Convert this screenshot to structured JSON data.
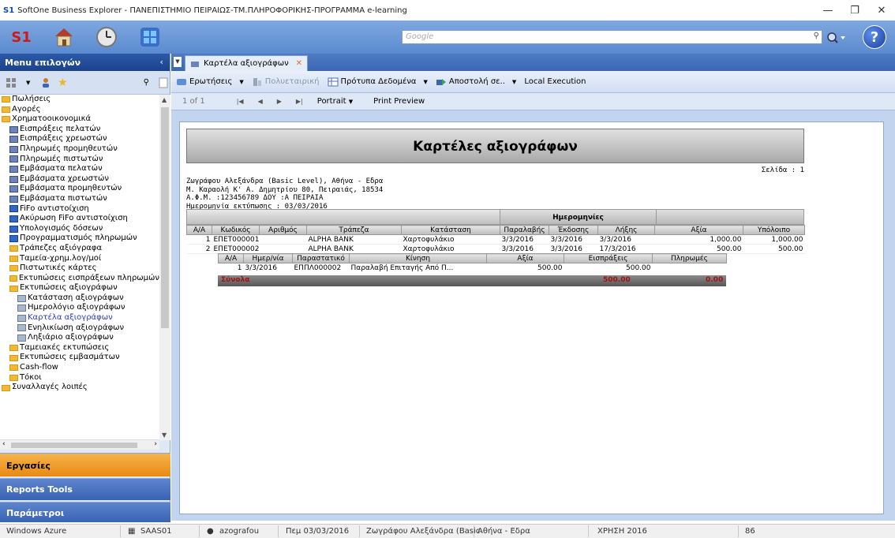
{
  "window": {
    "logo": "S1",
    "title": "SoftOne Business Explorer - ΠΑΝΕΠΙΣΤΗΜΙΟ ΠΕΙΡΑΙΩΣ-ΤΜ.ΠΛΗΡΟΦΟΡΙΚΗΣ-ΠΡΟΓΡΑΜΜΑ e-learning"
  },
  "search": {
    "placeholder": "Google"
  },
  "sidebar": {
    "header": "Menu επιλογών",
    "tree": [
      {
        "label": "Πωλήσεις",
        "type": "folder",
        "indent": 0
      },
      {
        "label": "Αγορές",
        "type": "folder",
        "indent": 0
      },
      {
        "label": "Χρηματοοικονομικά",
        "type": "folder",
        "indent": 0
      },
      {
        "label": "Εισπράξεις πελατών",
        "type": "doc",
        "indent": 1
      },
      {
        "label": "Εισπράξεις χρεωστών",
        "type": "doc",
        "indent": 1
      },
      {
        "label": "Πληρωμές προμηθευτών",
        "type": "doc",
        "indent": 1
      },
      {
        "label": "Πληρωμές πιστωτών",
        "type": "doc",
        "indent": 1
      },
      {
        "label": "Εμβάσματα πελατών",
        "type": "doc",
        "indent": 1
      },
      {
        "label": "Εμβάσματα χρεωστών",
        "type": "doc",
        "indent": 1
      },
      {
        "label": "Εμβάσματα προμηθευτών",
        "type": "doc",
        "indent": 1
      },
      {
        "label": "Εμβάσματα πιστωτών",
        "type": "doc",
        "indent": 1
      },
      {
        "label": "FiFo αντιστοίχιση",
        "type": "fifo",
        "indent": 1
      },
      {
        "label": "Ακύρωση FiFo αντιστοίχιση",
        "type": "fifo",
        "indent": 1
      },
      {
        "label": "Υπολογισμός δόσεων",
        "type": "fifo",
        "indent": 1
      },
      {
        "label": "Προγραμματισμός πληρωμών",
        "type": "fifo",
        "indent": 1
      },
      {
        "label": "Τράπεζες αξιόγραφα",
        "type": "folder",
        "indent": 1
      },
      {
        "label": "Ταμεία-χρημ.λογ/μοί",
        "type": "folder",
        "indent": 1
      },
      {
        "label": "Πιστωτικές κάρτες",
        "type": "folder",
        "indent": 1
      },
      {
        "label": "Εκτυπώσεις εισπράξεων πληρωμών",
        "type": "folder",
        "indent": 1
      },
      {
        "label": "Εκτυπώσεις αξιογράφων",
        "type": "folder",
        "indent": 1
      },
      {
        "label": "Κατάσταση αξιογράφων",
        "type": "report",
        "indent": 2
      },
      {
        "label": "Ημερολόγιο αξιογράφων",
        "type": "report",
        "indent": 2
      },
      {
        "label": "Καρτέλα αξιογράφων",
        "type": "report",
        "indent": 2,
        "active": true
      },
      {
        "label": "Ενηλικίωση αξιογράφων",
        "type": "report",
        "indent": 2
      },
      {
        "label": "Ληξιάριο αξιογράφων",
        "type": "report",
        "indent": 2
      },
      {
        "label": "Ταμειακές εκτυπώσεις",
        "type": "folder",
        "indent": 1
      },
      {
        "label": "Εκτυπώσεις εμβασμάτων",
        "type": "folder",
        "indent": 1
      },
      {
        "label": "Cash-flow",
        "type": "folder",
        "indent": 1
      },
      {
        "label": "Τόκοι",
        "type": "folder",
        "indent": 1
      },
      {
        "label": "Συναλλαγές λοιπές",
        "type": "folder",
        "indent": 0
      }
    ],
    "nav": {
      "ergasies": "Εργασίες",
      "reports": "Reports Tools",
      "params": "Παράμετροι"
    }
  },
  "tab": {
    "label": "Καρτέλα αξιογράφων"
  },
  "toolbar": {
    "queries": "Ερωτήσεις",
    "multi": "Πολυεταιρική",
    "templates": "Πρότυπα Δεδομένα",
    "send": "Αποστολή σε..",
    "local": "Local Execution"
  },
  "pager": {
    "page_text": "1 of 1",
    "portrait": "Portrait",
    "print_preview": "Print Preview"
  },
  "report": {
    "title": "Καρτέλες αξιογράφων",
    "page_label": "Σελίδα : 1",
    "company": [
      "Ζωγράφου Αλεξάνδρα (Basic Level), Αθήνα - Εδρα",
      "Μ. Καραολή Κ' Α. Δημητρίου 80, Πειραιάς, 18534",
      "Α.Φ.Μ. :123456789 ΔΟΥ :Α ΠΕΙΡΑΙΑ",
      "Ημερομηνία εκτύπωσης : 03/03/2016"
    ],
    "dates_header": "Ημερομηνίες",
    "columns": [
      "Α/Α",
      "Κωδικός",
      "Αριθμός",
      "Τράπεζα",
      "Κατάσταση",
      "Παραλαβής",
      "Έκδοσης",
      "Λήξης",
      "Αξία",
      "Υπόλοιπο"
    ],
    "rows": [
      [
        "1",
        "ΕΠΕΤ000001",
        "",
        "ALPHA BANK",
        "Χαρτοφυλάκιο",
        "3/3/2016",
        "3/3/2016",
        "3/3/2016",
        "1,000.00",
        "1,000.00"
      ],
      [
        "2",
        "ΕΠΕΤ000002",
        "",
        "ALPHA BANK",
        "Χαρτοφυλάκιο",
        "3/3/2016",
        "3/3/2016",
        "17/3/2016",
        "500.00",
        "500.00"
      ]
    ],
    "sub_columns": [
      "Α/Α",
      "Ημερ/νία",
      "Παραστατικό",
      "Κίνηση",
      "Αξία",
      "Εισπράξεις",
      "Πληρωμές"
    ],
    "sub_rows": [
      [
        "1",
        "3/3/2016",
        "ΕΠΠΛ000002",
        "Παραλαβή Επιταγής Από Π...",
        "500.00",
        "500.00",
        ""
      ]
    ],
    "totals": {
      "label": "Σύνολα",
      "income": "500.00",
      "payments": "0.00"
    }
  },
  "statusbar": {
    "server": "Windows Azure",
    "company_code": "SAAS01",
    "user": "azografou",
    "date": "Πεμ 03/03/2016",
    "company": "Ζωγράφου Αλεξάνδρα (Basic",
    "branch": "Αθήνα - Εδρα",
    "year": "ΧΡΗΣΗ 2016",
    "num": "86"
  }
}
